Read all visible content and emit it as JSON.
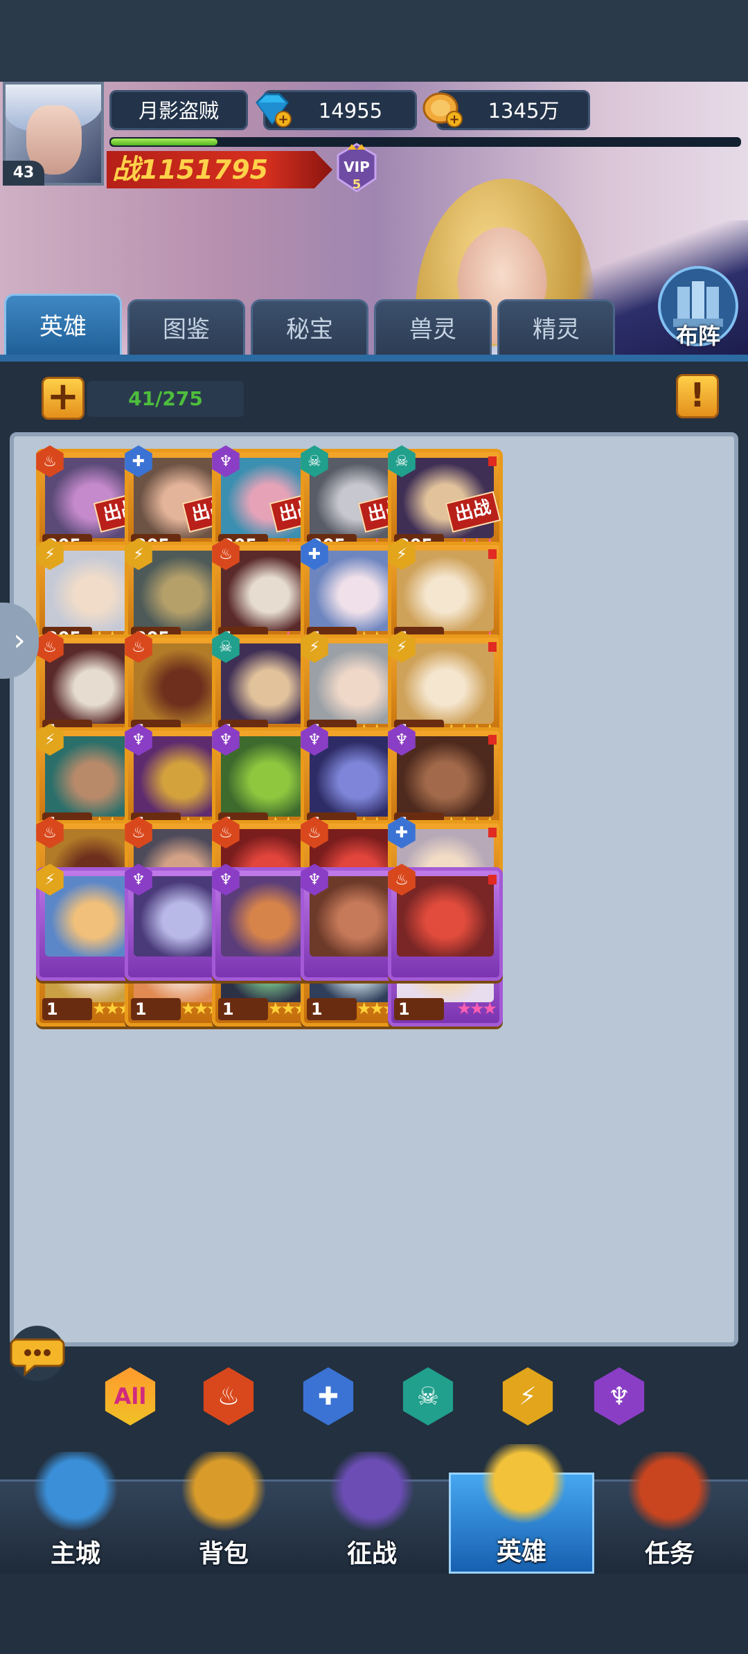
{
  "player": {
    "name": "月影盗贼",
    "level": "43",
    "gems": "14955",
    "gold": "1345万",
    "power_prefix": "战",
    "power": "1151795",
    "vip_label": "VIP",
    "vip_level": "5",
    "exp_fraction": 0.17
  },
  "tabs": [
    {
      "label": "英雄",
      "active": true
    },
    {
      "label": "图鉴",
      "active": false
    },
    {
      "label": "秘宝",
      "active": false
    },
    {
      "label": "兽灵",
      "active": false
    },
    {
      "label": "精灵",
      "active": false
    }
  ],
  "formation_button": "布阵",
  "hero_count": "41/275",
  "add_symbol": "+",
  "info_symbol": "!",
  "deploy_label": "出战",
  "colors": {
    "fire": "#d9481c",
    "water": "#3b73d4",
    "nature": "#20a08d",
    "light": "#e2a51c",
    "dark": "#8a3ec5"
  },
  "heroes": [
    {
      "level": "205",
      "faction": "fire",
      "stars": 2,
      "deployed": true,
      "frame": "gold"
    },
    {
      "level": "205",
      "faction": "water",
      "stars": 2,
      "deployed": true,
      "frame": "gold"
    },
    {
      "level": "205",
      "faction": "dark",
      "stars": 3,
      "deployed": true,
      "frame": "gold"
    },
    {
      "level": "205",
      "faction": "nature",
      "stars": 3,
      "deployed": true,
      "frame": "gold"
    },
    {
      "level": "205",
      "faction": "nature",
      "stars": 3,
      "deployed": true,
      "frame": "gold"
    },
    {
      "level": "205",
      "faction": "light",
      "stars": 4,
      "deployed": false,
      "frame": "gold"
    },
    {
      "level": "205",
      "faction": "light",
      "stars": 1,
      "deployed": false,
      "frame": "gold"
    },
    {
      "level": "1",
      "faction": "fire",
      "stars": 3,
      "deployed": false,
      "frame": "gold"
    },
    {
      "level": "1",
      "faction": "water",
      "stars": 4,
      "deployed": false,
      "frame": "gold"
    },
    {
      "level": "1",
      "faction": "light",
      "stars": 1,
      "deployed": false,
      "frame": "gold"
    },
    {
      "level": "1",
      "faction": "fire",
      "stars": 1,
      "deployed": false,
      "frame": "gold"
    },
    {
      "level": "1",
      "faction": "fire",
      "stars": 1,
      "deployed": false,
      "frame": "gold"
    },
    {
      "level": "1",
      "faction": "nature",
      "stars": 1,
      "deployed": false,
      "frame": "gold"
    },
    {
      "level": "1",
      "faction": "light",
      "stars": 4,
      "deployed": false,
      "frame": "gold"
    },
    {
      "level": "1",
      "faction": "light",
      "stars": 4,
      "deployed": false,
      "frame": "gold"
    },
    {
      "level": "1",
      "faction": "light",
      "stars": 4,
      "deployed": false,
      "frame": "gold"
    },
    {
      "level": "1",
      "faction": "dark",
      "stars": 4,
      "deployed": false,
      "frame": "gold"
    },
    {
      "level": "1",
      "faction": "dark",
      "stars": 4,
      "deployed": false,
      "frame": "gold"
    },
    {
      "level": "1",
      "faction": "dark",
      "stars": 4,
      "deployed": false,
      "frame": "gold"
    },
    {
      "level": "1",
      "faction": "dark",
      "stars": 4,
      "deployed": false,
      "frame": "gold"
    },
    {
      "level": "1",
      "faction": "fire",
      "stars": 4,
      "deployed": false,
      "frame": "gold"
    },
    {
      "level": "1",
      "faction": "fire",
      "stars": 4,
      "deployed": false,
      "frame": "gold"
    },
    {
      "level": "1",
      "faction": "fire",
      "stars": 4,
      "deployed": false,
      "frame": "gold"
    },
    {
      "level": "1",
      "faction": "fire",
      "stars": 4,
      "deployed": false,
      "frame": "gold"
    },
    {
      "level": "1",
      "faction": "water",
      "stars": 4,
      "deployed": false,
      "frame": "gold"
    },
    {
      "level": "1",
      "faction": "water",
      "stars": 4,
      "deployed": false,
      "frame": "gold"
    },
    {
      "level": "1",
      "faction": "nature",
      "stars": 4,
      "deployed": false,
      "frame": "gold"
    },
    {
      "level": "1",
      "faction": "nature",
      "stars": 4,
      "deployed": false,
      "frame": "gold"
    },
    {
      "level": "1",
      "faction": "nature",
      "stars": 4,
      "deployed": false,
      "frame": "gold"
    },
    {
      "level": "1",
      "faction": "light",
      "stars": 3,
      "deployed": false,
      "frame": "purple"
    },
    {
      "level": "",
      "faction": "light",
      "stars": 0,
      "deployed": false,
      "frame": "purple"
    },
    {
      "level": "",
      "faction": "dark",
      "stars": 0,
      "deployed": false,
      "frame": "purple"
    },
    {
      "level": "",
      "faction": "dark",
      "stars": 0,
      "deployed": false,
      "frame": "purple"
    },
    {
      "level": "",
      "faction": "dark",
      "stars": 0,
      "deployed": false,
      "frame": "purple"
    },
    {
      "level": "",
      "faction": "fire",
      "stars": 0,
      "deployed": false,
      "frame": "purple"
    }
  ],
  "filters": [
    {
      "label": "All",
      "icon": "all-filter-icon",
      "color": "#e4318f"
    },
    {
      "label": "",
      "icon": "fire-faction-icon",
      "color": "#d9481c"
    },
    {
      "label": "",
      "icon": "water-faction-icon",
      "color": "#3b73d4"
    },
    {
      "label": "",
      "icon": "nature-faction-icon",
      "color": "#20a08d"
    },
    {
      "label": "",
      "icon": "light-faction-icon",
      "color": "#e2a51c"
    },
    {
      "label": "",
      "icon": "dark-faction-icon",
      "color": "#8a3ec5"
    }
  ],
  "nav": [
    {
      "label": "主城",
      "icon": "castle-icon",
      "active": false
    },
    {
      "label": "背包",
      "icon": "chest-icon",
      "active": false
    },
    {
      "label": "征战",
      "icon": "portal-icon",
      "active": false
    },
    {
      "label": "英雄",
      "icon": "hero-helmet-icon",
      "active": true
    },
    {
      "label": "任务",
      "icon": "scroll-icon",
      "active": false
    }
  ]
}
